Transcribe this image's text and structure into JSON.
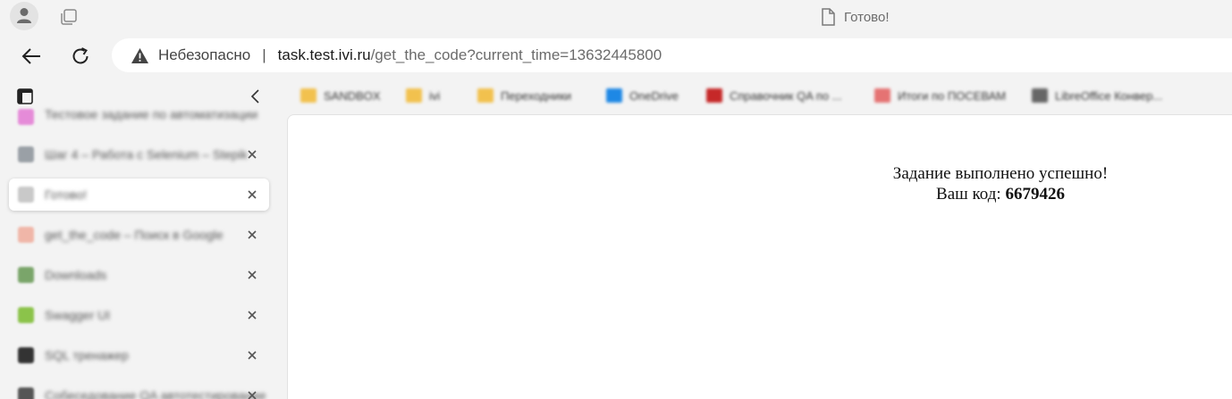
{
  "window": {
    "title": "Готово!"
  },
  "navbar": {
    "security_label": "Небезопасно",
    "separator": "|",
    "url_host": "task.test.ivi.ru",
    "url_path": "/get_the_code?current_time=13632445800"
  },
  "sidebar": {
    "tabs": [
      {
        "label": "Тестовое задание по автоматизации",
        "icon_color": "#e58bd8"
      },
      {
        "label": "Шаг 4 – Работа с Selenium – Stepik",
        "icon_color": "#9aa0a6"
      },
      {
        "label": "Готово!",
        "icon_color": "#c9c9c9"
      },
      {
        "label": "get_the_code – Поиск в Google",
        "icon_color": "#f0b6a8"
      },
      {
        "label": "Downloads",
        "icon_color": "#7aa56a"
      },
      {
        "label": "Swagger UI",
        "icon_color": "#8bc34a"
      },
      {
        "label": "SQL тренажер",
        "icon_color": "#333333"
      },
      {
        "label": "Собеседование QA автотестирование",
        "icon_color": "#555555"
      }
    ]
  },
  "bookmarks": [
    {
      "label": "SANDBOX",
      "icon": "folder-icon",
      "color": "#f2c14e"
    },
    {
      "label": "ivi",
      "icon": "folder-icon",
      "color": "#f2c14e"
    },
    {
      "label": "Переходники",
      "icon": "folder-icon",
      "color": "#f2c14e"
    },
    {
      "label": "OneDrive",
      "icon": "cloud-icon",
      "color": "#1e88e5"
    },
    {
      "label": "Справочник QA по ...",
      "icon": "doc-icon",
      "color": "#c62828"
    },
    {
      "label": "Итоги по ПОСЕВАМ",
      "icon": "app-icon",
      "color": "#e57373"
    },
    {
      "label": "LibreOffice Конвер...",
      "icon": "file-icon",
      "color": "#666666"
    }
  ],
  "page": {
    "line1": "Задание выполнено успешно!",
    "line2_prefix": "Ваш код: ",
    "code": "6679426"
  }
}
